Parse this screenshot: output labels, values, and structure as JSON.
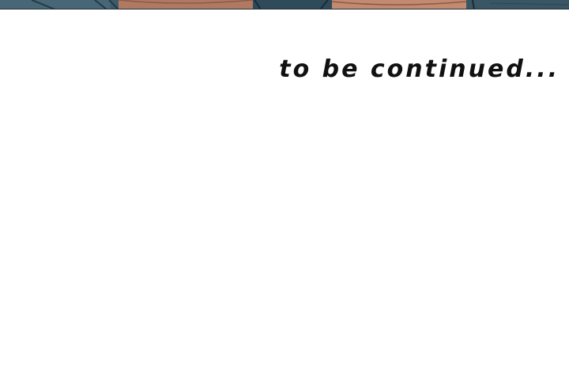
{
  "caption": {
    "text": "to be continued..."
  },
  "colors": {
    "background": "#ffffff",
    "text": "#111111",
    "art_base": "#3d5a6b",
    "art_dark": "#233a47",
    "art_skin": "#b07a62"
  }
}
